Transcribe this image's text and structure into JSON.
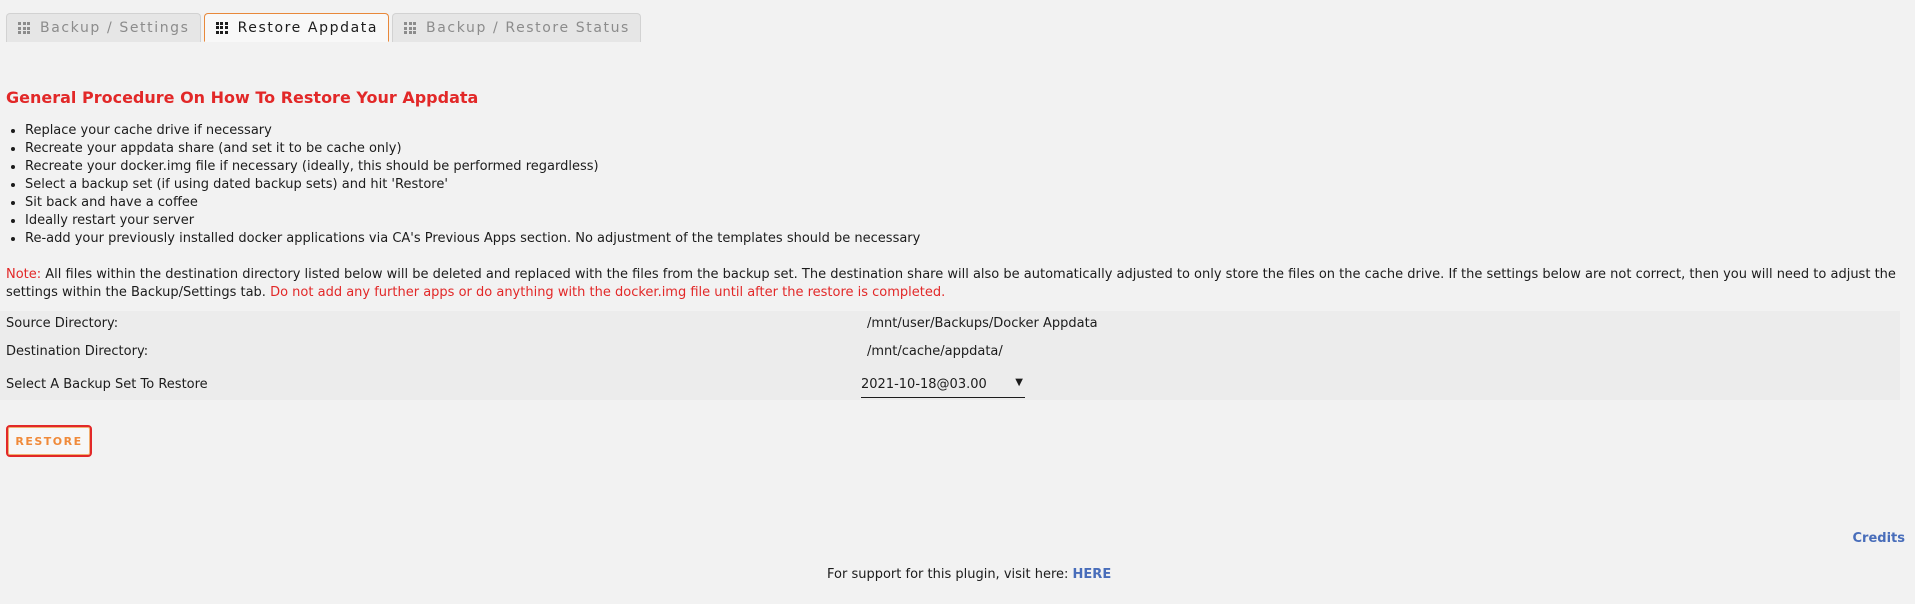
{
  "tabs": [
    {
      "label": "Backup / Settings",
      "active": false
    },
    {
      "label": "Restore Appdata",
      "active": true
    },
    {
      "label": "Backup / Restore Status",
      "active": false
    }
  ],
  "heading": "General Procedure On How To Restore Your Appdata",
  "steps": [
    "Replace your cache drive if necessary",
    "Recreate your appdata share (and set it to be cache only)",
    "Recreate your docker.img file if necessary (ideally, this should be performed regardless)",
    "Select a backup set (if using dated backup sets) and hit 'Restore'",
    "Sit back and have a coffee",
    "Ideally restart your server",
    "Re-add your previously installed docker applications via CA's Previous Apps section. No adjustment of the templates should be necessary"
  ],
  "note": {
    "prefix": "Note:",
    "text": " All files within the destination directory listed below will be deleted and replaced with the files from the backup set. The destination share will also be automatically adjusted to only store the files on the cache drive. If the settings below are not correct, then you will need to adjust the settings within the Backup/Settings tab. ",
    "warning": "Do not add any further apps or do anything with the docker.img file until after the restore is completed."
  },
  "settings": {
    "source_label": "Source Directory:",
    "source_value": "/mnt/user/Backups/Docker Appdata",
    "destination_label": "Destination Directory:",
    "destination_value": "/mnt/cache/appdata/",
    "backup_set_label": "Select A Backup Set To Restore",
    "backup_set_selected": "2021-10-18@03.00"
  },
  "restore_button": "RESTORE",
  "credits_link": "Credits",
  "support": {
    "text": "For support for this plugin, visit here: ",
    "link": "HERE"
  },
  "colors": {
    "accent_red": "#e22828",
    "link_blue": "#486dba",
    "active_tab_border": "#e8883a",
    "button_text": "#f08a3a"
  }
}
